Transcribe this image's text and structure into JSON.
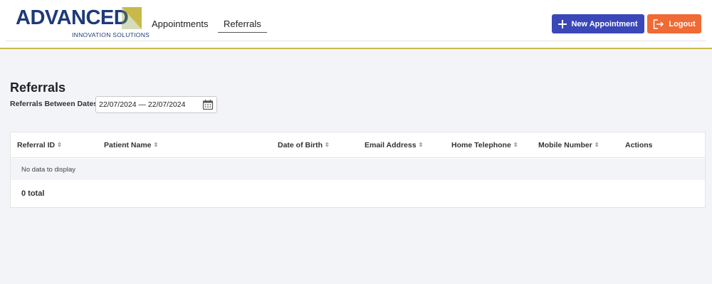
{
  "brand": {
    "name": "ADVANCED",
    "tagline": "INNOVATION SOLUTIONS",
    "colors": {
      "primary": "#1f3a7a",
      "accent": "#c9b94a"
    }
  },
  "nav": {
    "items": [
      {
        "label": "Appointments",
        "active": false
      },
      {
        "label": "Referrals",
        "active": true
      }
    ]
  },
  "actions": {
    "new_appointment": {
      "label": "New Appointment",
      "icon": "plus-icon",
      "color": "#3a47b8"
    },
    "logout": {
      "label": "Logout",
      "icon": "logout-icon",
      "color": "#f06a35"
    }
  },
  "page": {
    "title": "Referrals",
    "filter_label": "Referrals Between Dates",
    "date_range": "22/07/2024 — 22/07/2024",
    "date_icon": "calendar-icon"
  },
  "table": {
    "columns": [
      {
        "label": "Referral ID",
        "sortable": true
      },
      {
        "label": "Patient Name",
        "sortable": true
      },
      {
        "label": "Date of Birth",
        "sortable": true
      },
      {
        "label": "Email Address",
        "sortable": true
      },
      {
        "label": "Home Telephone",
        "sortable": true
      },
      {
        "label": "Mobile Number",
        "sortable": true
      },
      {
        "label": "Actions",
        "sortable": false
      }
    ],
    "rows": [],
    "empty_text": "No data to display",
    "total_text": "0 total"
  }
}
